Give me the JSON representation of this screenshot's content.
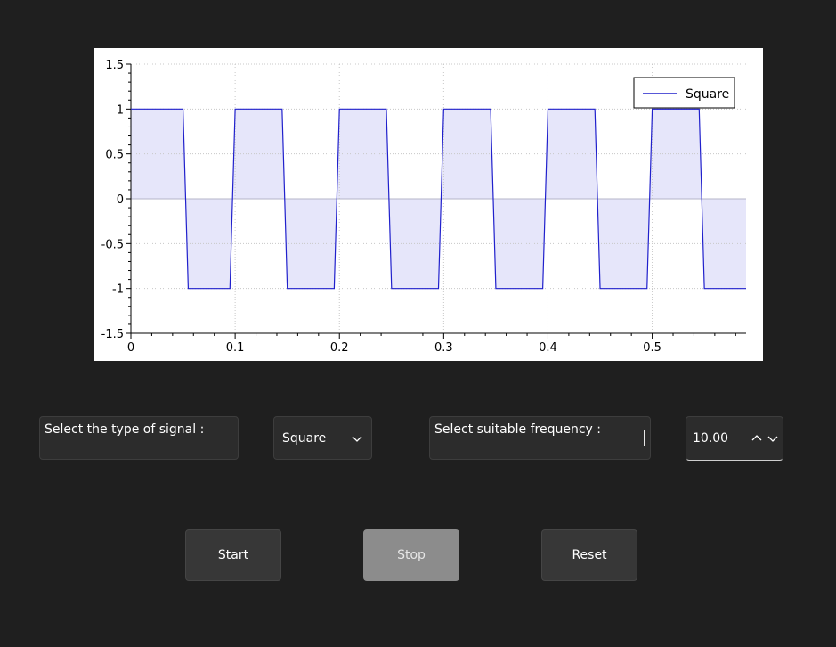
{
  "chart_data": {
    "type": "line",
    "x_ticks": [
      "0",
      "0.1",
      "0.2",
      "0.3",
      "0.4",
      "0.5"
    ],
    "y_ticks": [
      "1.5",
      "1",
      "0.5",
      "0",
      "-0.5",
      "-1",
      "-1.5"
    ],
    "xlim": [
      0,
      0.59
    ],
    "ylim": [
      -1.5,
      1.5
    ],
    "grid": true,
    "legend_position": "top-right",
    "fill_to_zero": true,
    "series": [
      {
        "name": "Square",
        "color": "#2020cc",
        "fill_color": "#e6e6fa",
        "points": [
          [
            0,
            1
          ],
          [
            0.05,
            1
          ],
          [
            0.055,
            -1
          ],
          [
            0.095,
            -1
          ],
          [
            0.1,
            1
          ],
          [
            0.145,
            1
          ],
          [
            0.15,
            -1
          ],
          [
            0.195,
            -1
          ],
          [
            0.2,
            1
          ],
          [
            0.245,
            1
          ],
          [
            0.25,
            -1
          ],
          [
            0.295,
            -1
          ],
          [
            0.3,
            1
          ],
          [
            0.345,
            1
          ],
          [
            0.35,
            -1
          ],
          [
            0.395,
            -1
          ],
          [
            0.4,
            1
          ],
          [
            0.445,
            1
          ],
          [
            0.45,
            -1
          ],
          [
            0.495,
            -1
          ],
          [
            0.5,
            1
          ],
          [
            0.545,
            1
          ],
          [
            0.55,
            -1
          ],
          [
            0.59,
            -1
          ]
        ]
      }
    ]
  },
  "controls": {
    "signal_label": "Select the type of signal :",
    "signal_value": "Square",
    "frequency_label": "Select suitable frequency :",
    "frequency_value": "10.00"
  },
  "buttons": {
    "start": "Start",
    "stop": "Stop",
    "reset": "Reset"
  }
}
